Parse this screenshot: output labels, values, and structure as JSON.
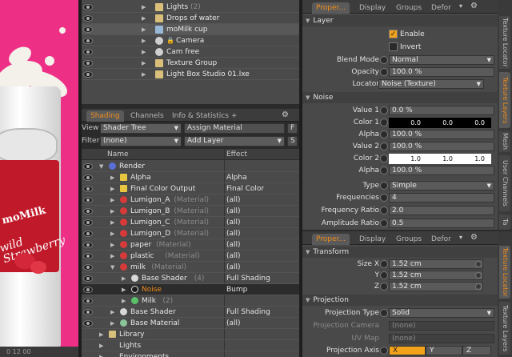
{
  "colors": {
    "accent": "#f08c1c",
    "viewport_bg": "#ee2f86",
    "panel": "#4a4a4a",
    "checked": "#f3a21b"
  },
  "viewport": {
    "can_brand": "moMilk",
    "can_tagline_1": "wild",
    "can_tagline_2": "Strawberry",
    "ruler_ticks": "0  12  00"
  },
  "items_list": [
    {
      "label": "Lights",
      "count": "(2)",
      "icon": "folder-icon",
      "indent": 1
    },
    {
      "label": "Drops of water",
      "count": "",
      "icon": "folder-icon",
      "indent": 1
    },
    {
      "label": "moMilk cup",
      "count": "",
      "icon": "mesh-icon",
      "indent": 1
    },
    {
      "label": "Camera",
      "count": "",
      "icon": "camera-icon",
      "indent": 1,
      "locked": true
    },
    {
      "label": "Cam free",
      "count": "",
      "icon": "camera-icon",
      "indent": 1
    },
    {
      "label": "Texture Group",
      "count": "",
      "icon": "group-icon",
      "indent": 1
    },
    {
      "label": "Light Box Studio 01.lxe",
      "count": "",
      "icon": "folder-icon",
      "indent": 1
    }
  ],
  "shading_panel": {
    "tabs": [
      {
        "label": "Shading",
        "active": true
      },
      {
        "label": "Channels",
        "active": false
      },
      {
        "label": "Info & Statistics",
        "active": false
      },
      {
        "label": "+",
        "active": false
      }
    ],
    "view_label": "View",
    "view_value": "Shader Tree",
    "assign_material": "Assign Material",
    "f_button": "F",
    "filter_label": "Filter",
    "filter_value": "(none)",
    "add_layer": "Add Layer",
    "s_button": "S",
    "col_name": "Name",
    "col_effect": "Effect"
  },
  "shader_tree": [
    {
      "name": "Render",
      "tag": "",
      "effect": "",
      "icon": "render-icon",
      "level": 0
    },
    {
      "name": "Alpha",
      "tag": "",
      "effect": "Alpha",
      "icon": "output-icon",
      "level": 1
    },
    {
      "name": "Final Color Output",
      "tag": "",
      "effect": "Final Color",
      "icon": "output-icon",
      "level": 1
    },
    {
      "name": "Lumigon_A",
      "tag": "(Material)",
      "effect": "(all)",
      "icon": "material-icon",
      "level": 1
    },
    {
      "name": "Lumigon_B",
      "tag": "(Material)",
      "effect": "(all)",
      "icon": "material-icon",
      "level": 1
    },
    {
      "name": "Lumigon_C",
      "tag": "(Material)",
      "effect": "(all)",
      "icon": "material-icon",
      "level": 1
    },
    {
      "name": "Lumigon_D",
      "tag": "(Material)",
      "effect": "(all)",
      "icon": "material-icon",
      "level": 1
    },
    {
      "name": "paper",
      "tag": "(Material)",
      "effect": "(all)",
      "icon": "material-icon",
      "level": 1
    },
    {
      "name": "plastic",
      "tag": "(Material)",
      "effect": "(all)",
      "icon": "material-icon",
      "level": 1
    },
    {
      "name": "milk",
      "tag": "(Material)",
      "effect": "(all)",
      "icon": "material-icon",
      "level": 1
    },
    {
      "name": "Base Shader",
      "tag": "(4)",
      "effect": "Full Shading",
      "icon": "shader-icon",
      "level": 2
    },
    {
      "name": "Noise",
      "tag": "",
      "effect": "Bump",
      "icon": "noise-icon",
      "level": 2,
      "selected": true
    },
    {
      "name": "Milk",
      "tag": "(2)",
      "effect": "",
      "icon": "mask-icon",
      "level": 2
    },
    {
      "name": "Base Shader",
      "tag": "",
      "effect": "Full Shading",
      "icon": "shader-icon",
      "level": 1
    },
    {
      "name": "Base Material",
      "tag": "",
      "effect": "(all)",
      "icon": "base-material-icon",
      "level": 1
    },
    {
      "name": "Library",
      "tag": "",
      "effect": "",
      "icon": "library-icon",
      "level": 0
    },
    {
      "name": "Lights",
      "tag": "",
      "effect": "",
      "icon": "lights-icon",
      "level": 0
    },
    {
      "name": "Environments",
      "tag": "",
      "effect": "",
      "icon": "environments-icon",
      "level": 0
    }
  ],
  "top_props": {
    "tabs": [
      {
        "label": "Proper...",
        "active": true
      },
      {
        "label": "Display",
        "active": false
      },
      {
        "label": "Groups",
        "active": false
      },
      {
        "label": "Defor",
        "active": false
      }
    ],
    "side_tabs": [
      "Texture Locator",
      "Texture Layers",
      "Mesh",
      "User Channels",
      "Ta"
    ],
    "layer_section": "Layer",
    "enable_label": "Enable",
    "invert_label": "Invert",
    "blend_mode_label": "Blend Mode",
    "blend_mode_value": "Normal",
    "opacity_label": "Opacity",
    "opacity_value": "100.0 %",
    "locator_label": "Locator",
    "locator_value": "Noise (Texture)",
    "noise_section": "Noise",
    "value1_label": "Value 1",
    "value1_value": "0.0 %",
    "color1_label": "Color 1",
    "color1_values": [
      "0.0",
      "0.0",
      "0.0"
    ],
    "alpha1_label": "Alpha",
    "alpha1_value": "100.0 %",
    "value2_label": "Value 2",
    "value2_value": "100.0 %",
    "color2_label": "Color 2",
    "color2_values": [
      "1.0",
      "1.0",
      "1.0"
    ],
    "alpha2_label": "Alpha",
    "alpha2_value": "100.0 %",
    "type_label": "Type",
    "type_value": "Simple",
    "frequencies_label": "Frequencies",
    "frequencies_value": "4",
    "freq_ratio_label": "Frequency Ratio",
    "freq_ratio_value": "2.0",
    "amp_ratio_label": "Amplitude Ratio",
    "amp_ratio_value": "0.5"
  },
  "bottom_props": {
    "tabs": [
      {
        "label": "Proper...",
        "active": true
      },
      {
        "label": "Display",
        "active": false
      },
      {
        "label": "Groups",
        "active": false
      },
      {
        "label": "Defor",
        "active": false
      }
    ],
    "side_tabs": [
      "Texture Locator",
      "Texture Layers"
    ],
    "transform_section": "Transform",
    "size_x_label": "Size X",
    "size_x_value": "1.52 cm",
    "size_y_label": "Y",
    "size_y_value": "1.52 cm",
    "size_z_label": "Z",
    "size_z_value": "1.52 cm",
    "projection_section": "Projection",
    "proj_type_label": "Projection Type",
    "proj_type_value": "Solid",
    "proj_camera_label": "Projection Camera",
    "proj_camera_value": "(none)",
    "uv_map_label": "UV Map",
    "uv_map_value": "(none)",
    "proj_axis_label": "Projection Axis",
    "proj_axis": [
      "X",
      "Y",
      "Z"
    ],
    "proj_axis_selected": "X"
  }
}
